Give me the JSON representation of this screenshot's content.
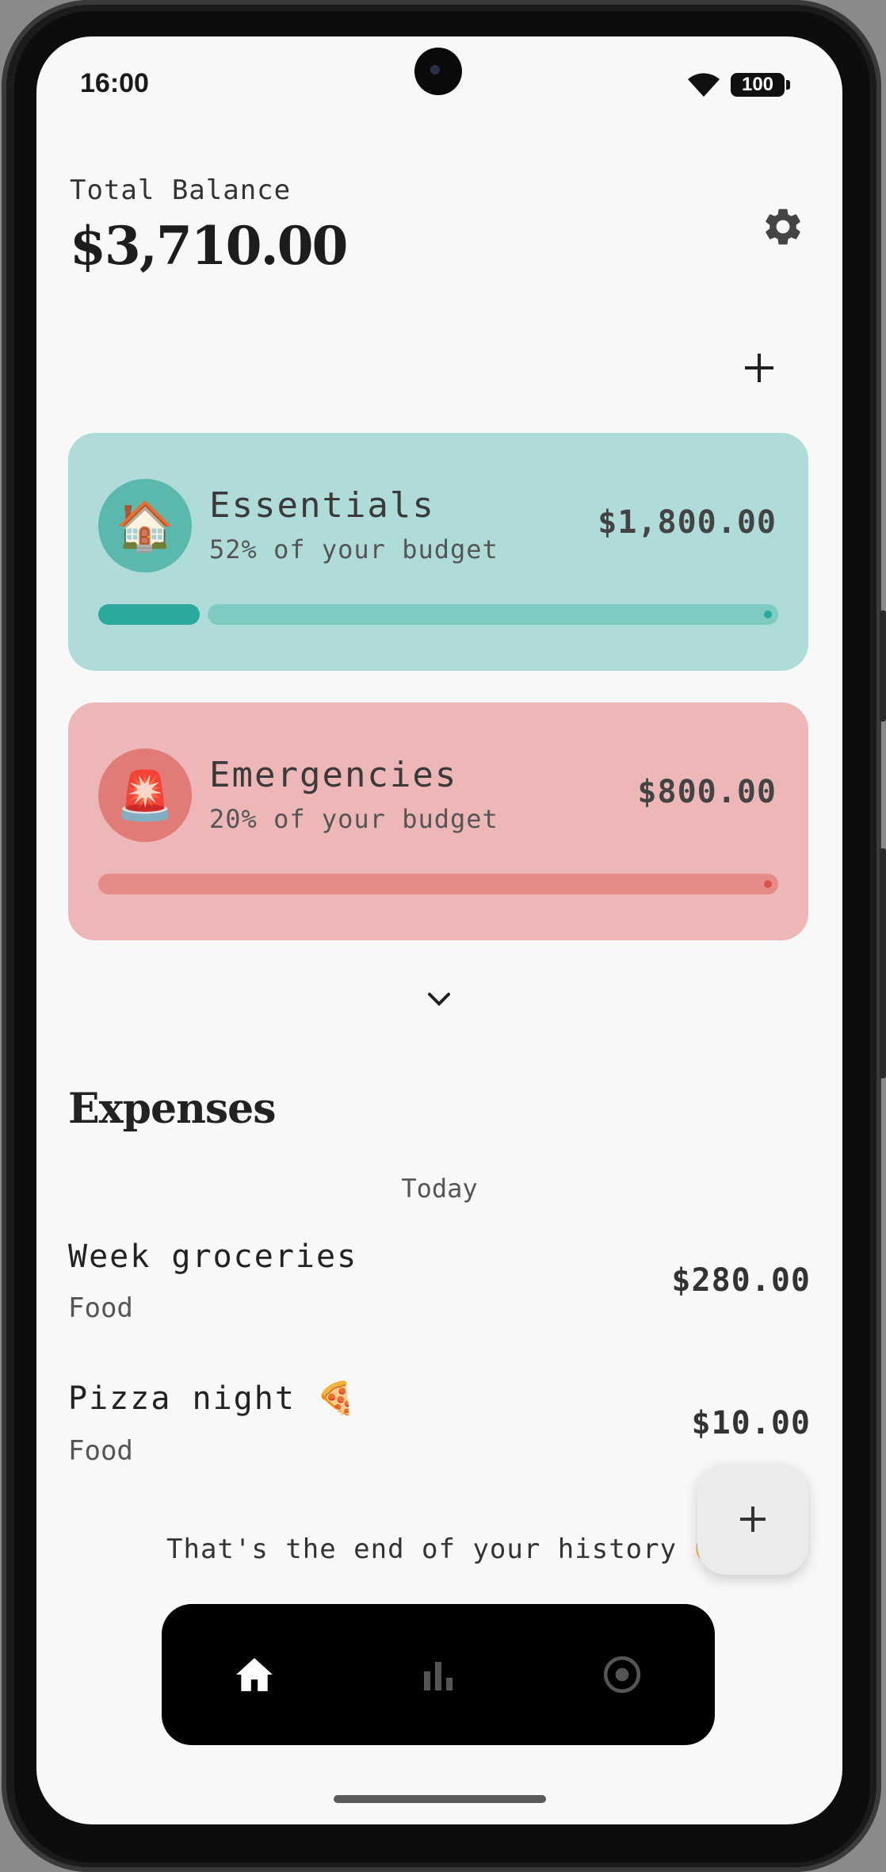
{
  "status_bar": {
    "time": "16:00",
    "battery": "100"
  },
  "header": {
    "balance_label": "Total Balance",
    "balance_amount": "$3,710.00"
  },
  "budgets": [
    {
      "icon": "🏠",
      "icon_name": "house-icon",
      "title": "Essentials",
      "subtitle": "52% of your budget",
      "amount": "$1,800.00",
      "progress": 0.15,
      "color": "#2aa99c"
    },
    {
      "icon": "🚨",
      "icon_name": "siren-icon",
      "title": "Emergencies",
      "subtitle": "20% of your budget",
      "amount": "$800.00",
      "progress": 0.0,
      "color": "#d9534f"
    }
  ],
  "expenses": {
    "title": "Expenses",
    "date_group": "Today",
    "items": [
      {
        "title": "Week groceries",
        "category": "Food",
        "amount": "$280.00"
      },
      {
        "title": "Pizza night 🍕",
        "category": "Food",
        "amount": "$10.00"
      }
    ],
    "end_text": "That's the end of your history 🤑"
  },
  "nav": {
    "items": [
      "home-icon",
      "bar-chart-icon",
      "target-icon"
    ],
    "active": "home-icon"
  },
  "colors": {
    "essentials_card": "#afdbd8",
    "emergencies_card": "#ecb7b6",
    "background": "#f8f8f8"
  }
}
